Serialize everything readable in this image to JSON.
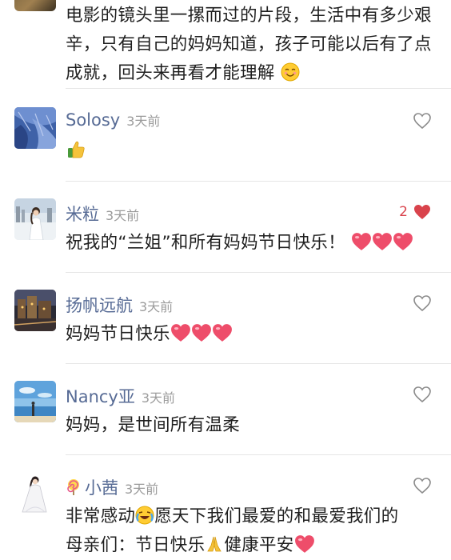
{
  "top_comment": {
    "text": "电影的镜头里一摞而过的片段，生活中有多少艰辛，只有自己的妈妈知道，孩子可能以后有了点成就，回头来再看才能理解"
  },
  "comments": [
    {
      "name": "Solosy",
      "time": "3天前",
      "text": "",
      "likes": ""
    },
    {
      "name": "米粒",
      "time": "3天前",
      "text": "祝我的“兰姐”和所有妈妈节日快乐！",
      "likes": "2"
    },
    {
      "name": "扬帆远航",
      "time": "3天前",
      "text": "妈妈节日快乐",
      "likes": ""
    },
    {
      "name": "Nancy亚",
      "time": "3天前",
      "text": "妈妈，是世间所有温柔",
      "likes": ""
    },
    {
      "name": "小茜",
      "time": "3天前",
      "text_line1": "非常感动",
      "text_line1b": "愿天下我们最爱的和最爱我们的",
      "text_line2a": "母亲们：节日快乐",
      "text_line2b": "健康平安",
      "likes": ""
    }
  ],
  "colors": {
    "name": "#576b95",
    "time": "#9b9b9b",
    "like_active": "#d9434c",
    "heart_emoji": "#ee4d6a"
  },
  "icons": {
    "like_empty": "heart-outline-icon",
    "like_filled": "heart-filled-icon",
    "thumbs_up": "thumbs-up-emoji",
    "smile": "smile-emoji",
    "heart": "heart-emoji",
    "pray": "pray-emoji",
    "crying_laugh": "crying-laugh-emoji",
    "lollipop": "lollipop-emoji"
  }
}
